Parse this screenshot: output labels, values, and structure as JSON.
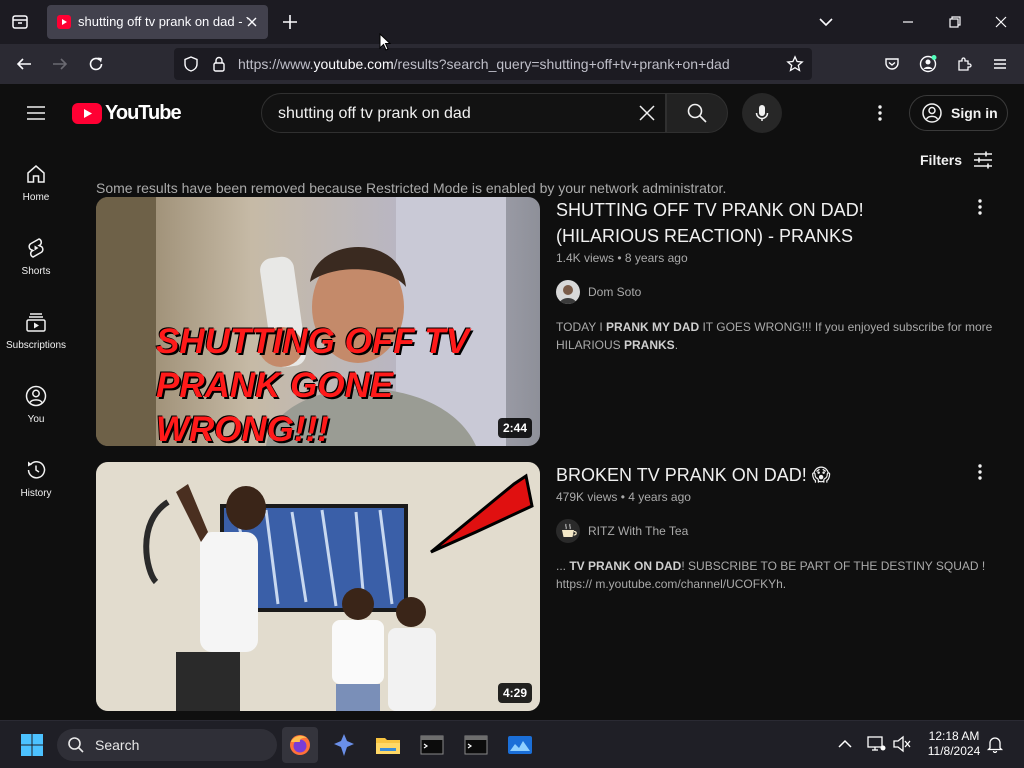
{
  "browser": {
    "tab_title": "shutting off tv prank on dad - YouTube",
    "url_prefix": "https://www.",
    "url_domain": "youtube.com",
    "url_path": "/results?search_query=shutting+off+tv+prank+on+dad"
  },
  "youtube": {
    "logo_text": "YouTube",
    "search_query": "shutting off tv prank on dad",
    "sign_in": "Sign in",
    "filters": "Filters",
    "restricted_notice": "Some results have been removed because Restricted Mode is enabled by your network administrator.",
    "sidebar": [
      {
        "label": "Home",
        "icon": "home-icon"
      },
      {
        "label": "Shorts",
        "icon": "shorts-icon"
      },
      {
        "label": "Subscriptions",
        "icon": "subscriptions-icon"
      },
      {
        "label": "You",
        "icon": "you-icon"
      },
      {
        "label": "History",
        "icon": "history-icon"
      }
    ],
    "results": [
      {
        "title": "SHUTTING OFF TV PRANK ON DAD! (HILARIOUS REACTION) - PRANKS",
        "views": "1.4K views",
        "age": "8 years ago",
        "channel": "Dom Soto",
        "duration": "2:44",
        "thumb_text_1": "SHUTTING OFF TV",
        "thumb_text_2": "PRANK GONE",
        "thumb_text_3": "WRONG!!!",
        "desc_1": "TODAY I ",
        "desc_2": "PRANK MY DAD",
        "desc_3": " IT GOES WRONG!!! If you enjoyed subscribe for more HILARIOUS ",
        "desc_4": "PRANKS",
        "desc_5": "."
      },
      {
        "title": "BROKEN TV PRANK ON DAD! 😱",
        "views": "479K views",
        "age": "4 years ago",
        "channel": "RITZ With The Tea",
        "duration": "4:29",
        "desc_1": "... ",
        "desc_2": "TV PRANK ON DAD",
        "desc_3": "! SUBSCRIBE TO BE PART OF THE DESTINY SQUAD ! https:// m.youtube.com/channel/UCOFKYh."
      }
    ]
  },
  "taskbar": {
    "search": "Search",
    "time": "12:18 AM",
    "date": "11/8/2024"
  },
  "colors": {
    "youtube_red": "#ff0033",
    "background": "#0f0f0f",
    "browser_chrome": "#1c1b22"
  }
}
